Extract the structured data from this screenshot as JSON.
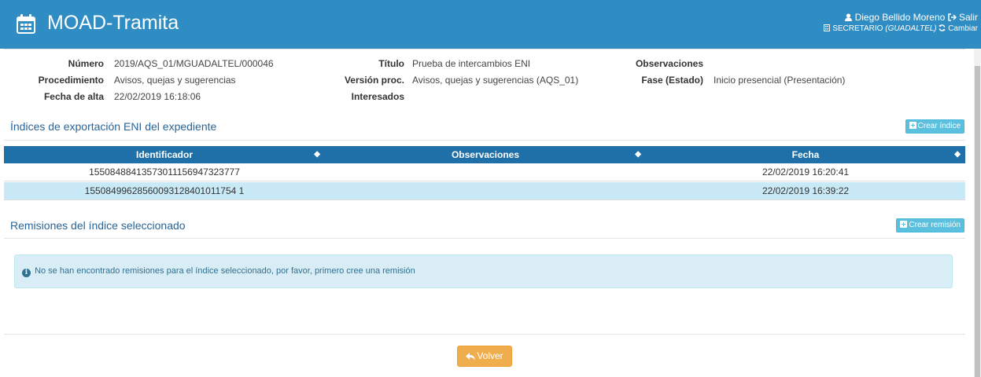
{
  "header": {
    "app_title": "MOAD-Tramita",
    "user_name": "Diego Bellido Moreno",
    "logout_label": "Salir",
    "role": "SECRETARIO",
    "org": "(GUADALTEL)",
    "change_label": "Cambiar"
  },
  "details": {
    "numero": {
      "label": "Número",
      "value": "2019/AQS_01/MGUADALTEL/000046"
    },
    "procedimiento": {
      "label": "Procedimiento",
      "value": "Avisos, quejas y sugerencias"
    },
    "fecha_alta": {
      "label": "Fecha de alta",
      "value": "22/02/2019 16:18:06"
    },
    "titulo": {
      "label": "Título",
      "value": "Prueba de intercambios ENI"
    },
    "version_proc": {
      "label": "Versión proc.",
      "value": "Avisos, quejas y sugerencias (AQS_01)"
    },
    "interesados": {
      "label": "Interesados",
      "value": ""
    },
    "observaciones": {
      "label": "Observaciones",
      "value": ""
    },
    "fase": {
      "label": "Fase (Estado)",
      "value": "Inicio presencial (Presentación)"
    }
  },
  "indices": {
    "title": "Índices de exportación ENI del expediente",
    "create_label": "Crear índice",
    "columns": [
      "Identificador",
      "Observaciones",
      "Fecha"
    ],
    "rows": [
      {
        "identificador": "15508488413573011156947323777",
        "observaciones": "",
        "fecha": "22/02/2019 16:20:41"
      },
      {
        "identificador": "15508499628560093128401011754 1",
        "observaciones": "",
        "fecha": "22/02/2019 16:39:22"
      }
    ]
  },
  "remisiones": {
    "title": "Remisiones del índice seleccionado",
    "create_label": "Crear remisión",
    "empty_message": "No se han encontrado remisiones para el índice seleccionado, por favor, primero cree una remisión"
  },
  "footer": {
    "back_label": "Volver"
  },
  "colors": {
    "header_bg": "#2f8dc4",
    "table_header_bg": "#1f6fa8",
    "selected_row_bg": "#c9e9f6",
    "info_button": "#5bc0de",
    "back_button": "#f0ad4e"
  }
}
